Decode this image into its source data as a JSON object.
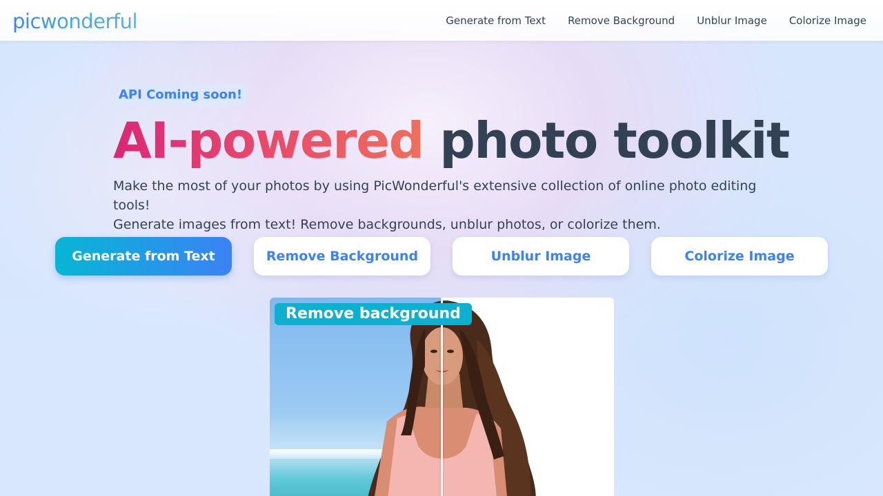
{
  "header": {
    "logo": "picwonderful",
    "nav": [
      {
        "label": "Generate from Text"
      },
      {
        "label": "Remove Background"
      },
      {
        "label": "Unblur Image"
      },
      {
        "label": "Colorize Image"
      }
    ]
  },
  "hero": {
    "badge": "API Coming soon!",
    "title_highlight": "AI-powered",
    "title_rest": "photo toolkit",
    "description_line1": "Make the most of your photos by using PicWonderful's extensive collection of online photo editing tools!",
    "description_line2": "Generate images from text! Remove backgrounds, unblur photos, or colorize them."
  },
  "actions": [
    {
      "label": "Generate from Text",
      "primary": true
    },
    {
      "label": "Remove Background",
      "primary": false
    },
    {
      "label": "Unblur Image",
      "primary": false
    },
    {
      "label": "Colorize Image",
      "primary": false
    }
  ],
  "preview": {
    "label": "Remove background"
  },
  "colors": {
    "accent_blue": "#3b82f6",
    "accent_cyan": "#06b6d4",
    "title_pink": "#db2777",
    "title_coral": "#ef6f5b",
    "text_dark": "#334155"
  }
}
